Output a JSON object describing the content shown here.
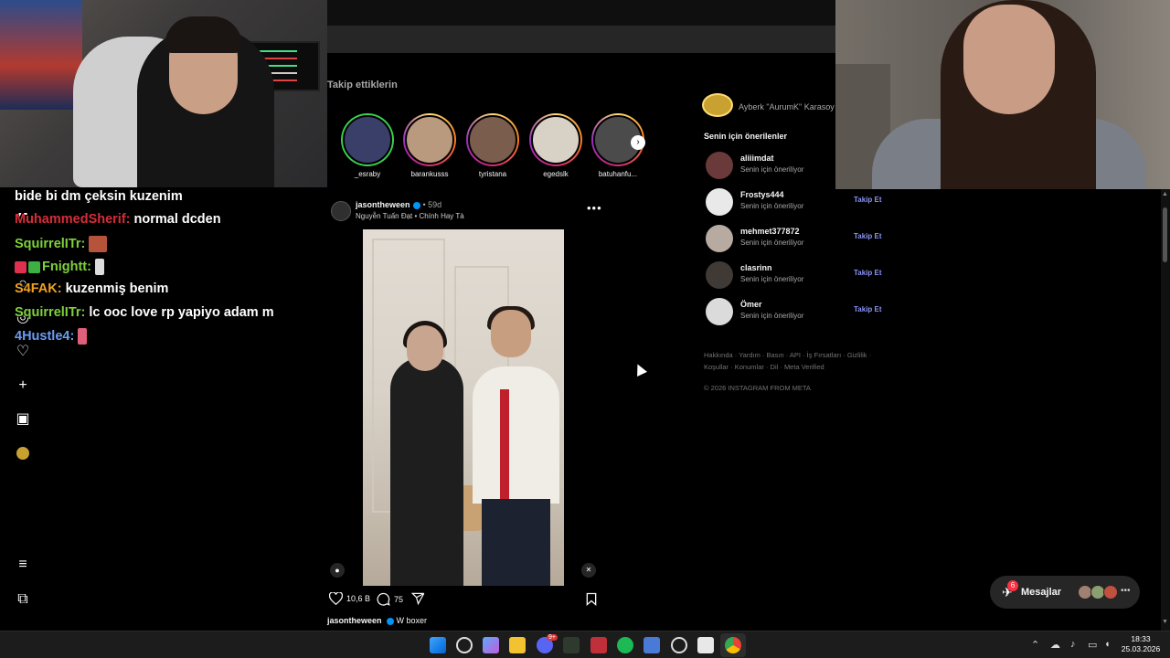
{
  "instagram": {
    "following_label": "Takip ettiklerin",
    "stories": [
      {
        "name": "_esraby",
        "ring": "green"
      },
      {
        "name": "barankusss",
        "ring": "gradient"
      },
      {
        "name": "tyristana",
        "ring": "gradient"
      },
      {
        "name": "egedslk",
        "ring": "gradient"
      },
      {
        "name": "batuhanfu...",
        "ring": "gradient"
      }
    ],
    "post": {
      "username": "jasontheween",
      "age": "• 59d",
      "subtitle": "Nguyễn Tuấn Đạt • Chính Hay Tà",
      "likes": "10,6 B",
      "comments": "75",
      "caption_user": "jasontheween",
      "caption_text": "W boxer"
    },
    "sidebar": {
      "current_user": "Ayberk \"AurumK\" Karasoy",
      "suggestions_title": "Senin için önerilenler",
      "suggestions": [
        {
          "user": "aliiimdat",
          "sub": "Senin için öneriliyor",
          "follow": ""
        },
        {
          "user": "Frostys444",
          "sub": "Senin için öneriliyor",
          "follow": "Takip Et"
        },
        {
          "user": "mehmet377872",
          "sub": "Senin için öneriliyor",
          "follow": "Takip Et"
        },
        {
          "user": "clasrinn",
          "sub": "Senin için öneriliyor",
          "follow": "Takip Et"
        },
        {
          "user": "Ömer",
          "sub": "Senin için öneriliyor",
          "follow": "Takip Et"
        }
      ],
      "footer_links_1": "Hakkında · Yardım · Basın · API · İş Fırsatları · Gizlilik ·",
      "footer_links_2": "Koşullar · Konumlar · Dil · Meta Verified",
      "copyright": "© 2026 INSTAGRAM FROM META"
    },
    "messages": {
      "label": "Mesajlar",
      "badge": "6"
    }
  },
  "chat": [
    {
      "user": "",
      "text": "bide bi dm çeksin kuzenim",
      "color": "#ffffff"
    },
    {
      "user": "MuhammedSherif:",
      "text": "normal dcden",
      "color": "#d62d3a"
    },
    {
      "user": "SquirrelITr:",
      "text": "",
      "color": "#7fd13b"
    },
    {
      "user": "Fnightt:",
      "text": "",
      "color": "#7fd13b"
    },
    {
      "user": "S4FAK:",
      "text": "kuzenmiş benim",
      "color": "#f0a020"
    },
    {
      "user": "SquirrelITr:",
      "text": "lc ooc love rp yapiyo adam m",
      "color": "#7fd13b"
    },
    {
      "user": "4Hustle4:",
      "text": "",
      "color": "#6b9cf0"
    }
  ],
  "taskbar": {
    "time": "18:33",
    "date": "25.03.2026",
    "discord_badge": "9+"
  },
  "colors": {
    "follow": "#8a93f7",
    "verified": "#0095f6",
    "badge": "#ff3040"
  }
}
